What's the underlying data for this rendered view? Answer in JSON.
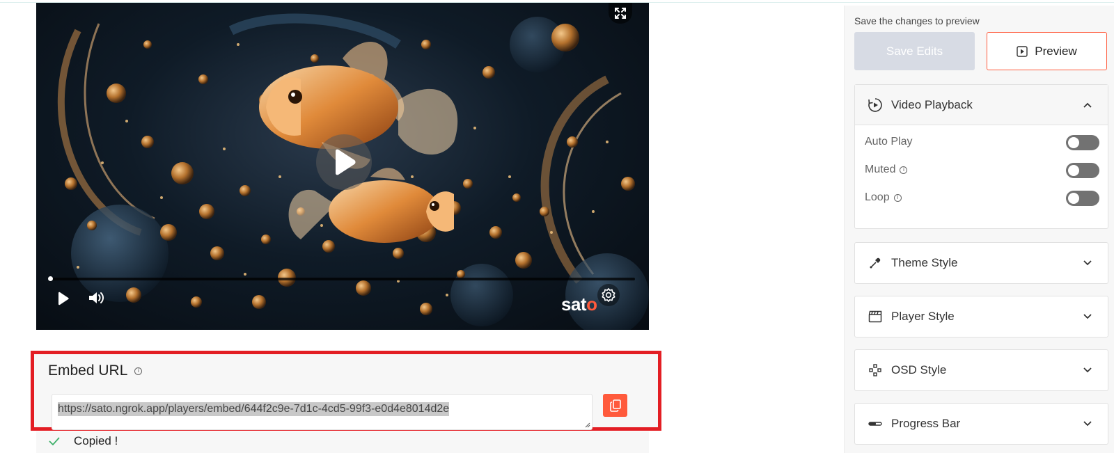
{
  "embed": {
    "title": "Embed URL",
    "url": "https://sato.ngrok.app/players/embed/644f2c9e-7d1c-4cd5-99f3-e0d4e8014d2e",
    "copied_text": "Copied !"
  },
  "player": {
    "brand_prefix": "sat",
    "brand_suffix": "o",
    "progress": 0,
    "icons": [
      "fullscreen-icon",
      "big-play-icon",
      "play-icon",
      "volume-icon",
      "settings-icon"
    ]
  },
  "panel": {
    "hint": "Save the changes to preview",
    "save_label": "Save Edits",
    "preview_label": "Preview",
    "sections": {
      "video_playback": {
        "label": "Video Playback",
        "options": {
          "auto_play": {
            "label": "Auto Play",
            "on": false
          },
          "muted": {
            "label": "Muted",
            "on": false
          },
          "loop": {
            "label": "Loop",
            "on": false
          }
        }
      },
      "theme_style": {
        "label": "Theme Style"
      },
      "player_style": {
        "label": "Player Style"
      },
      "osd_style": {
        "label": "OSD Style"
      },
      "progress_bar": {
        "label": "Progress Bar"
      }
    }
  },
  "colors": {
    "accent": "#ff5a3c",
    "highlight_border": "#e31e24",
    "toggle_off": "#727272",
    "save_disabled": "#d7dbe4"
  }
}
